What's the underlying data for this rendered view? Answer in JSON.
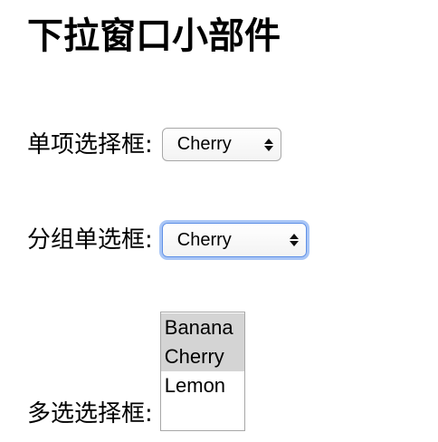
{
  "page": {
    "title": "下拉窗口小部件"
  },
  "single_select": {
    "label": "单项选择框:",
    "value": "Cherry"
  },
  "grouped_select": {
    "label": "分组单选框:",
    "value": "Cherry"
  },
  "multi_select": {
    "label": "多选选择框:",
    "options": [
      {
        "label": "Banana",
        "selected": true
      },
      {
        "label": "Cherry",
        "selected": true
      },
      {
        "label": "Lemon",
        "selected": false
      }
    ]
  },
  "colors": {
    "focus_border": "#5e8fe6",
    "focus_glow": "#a9c6f6",
    "selected_option_bg": "#d4d4d4"
  }
}
